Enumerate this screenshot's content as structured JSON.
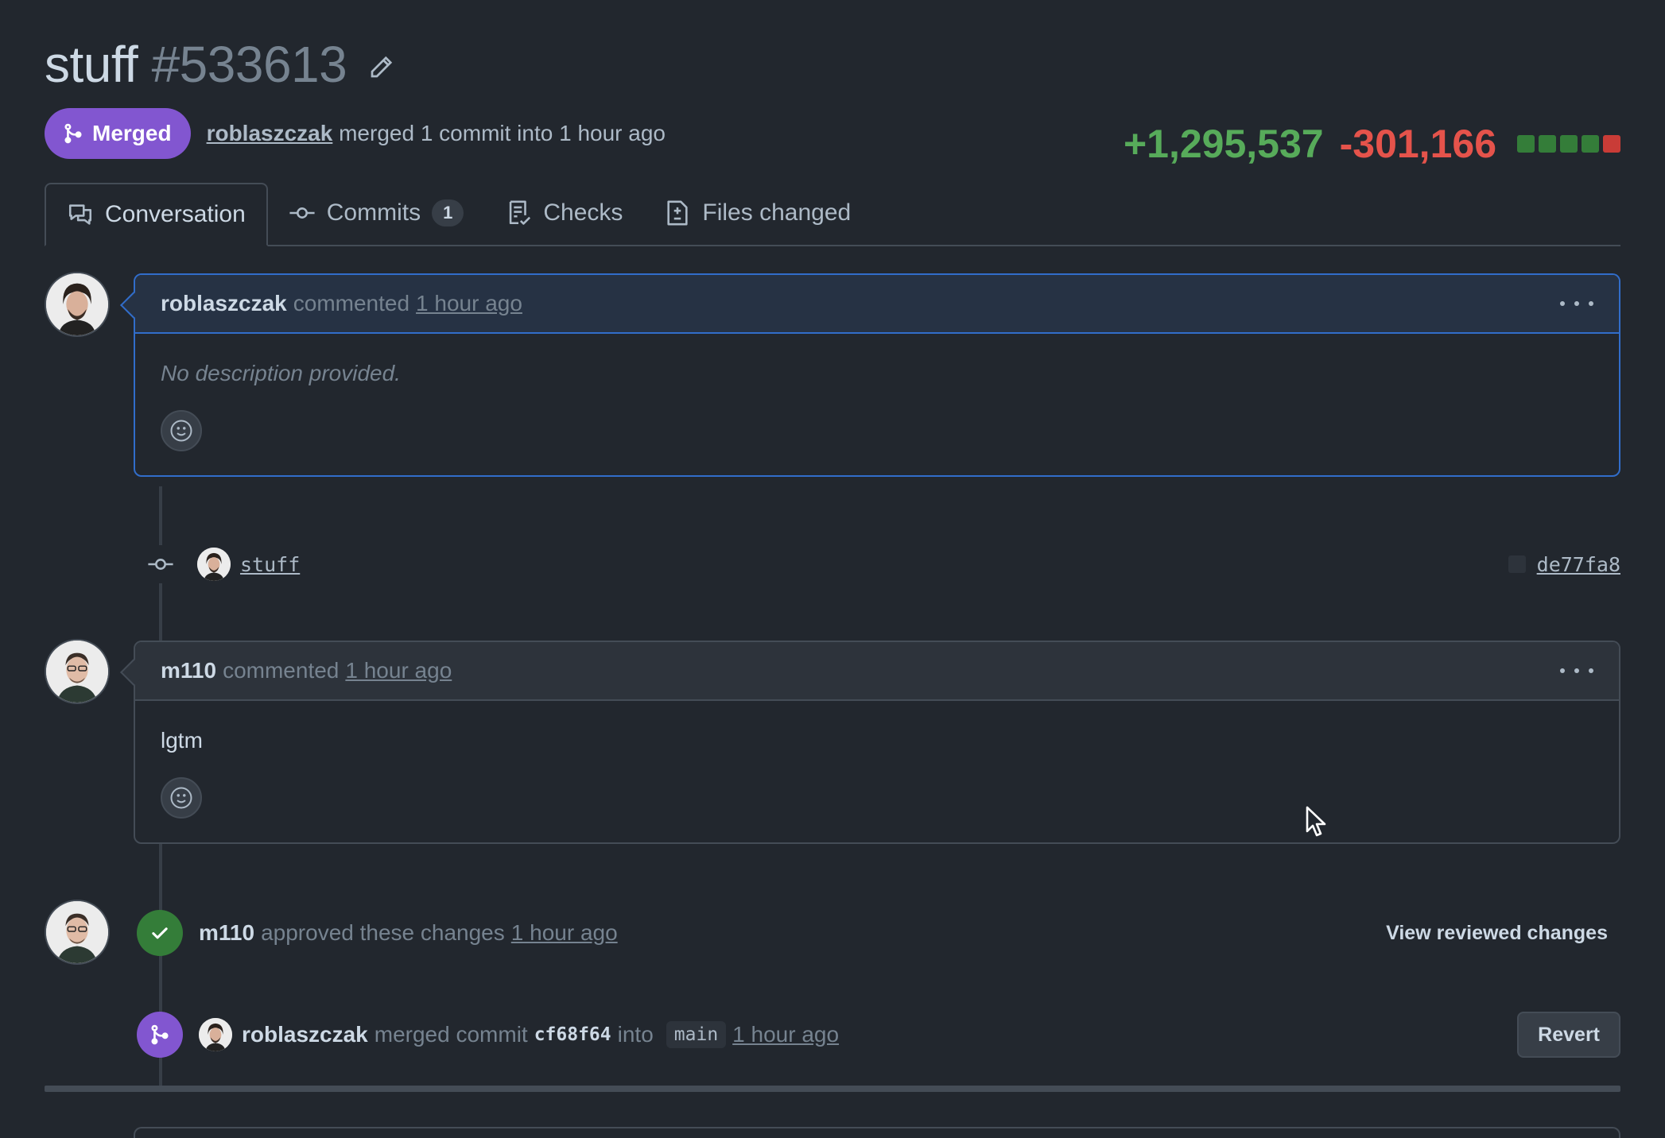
{
  "header": {
    "title": "stuff",
    "number": "#533613",
    "status_label": "Merged",
    "author": "roblaszczak",
    "meta_text": "merged 1 commit into  1 hour ago"
  },
  "diffstat": {
    "additions": "+1,295,537",
    "deletions": "-301,166",
    "bar_colors": [
      "#347d39",
      "#347d39",
      "#347d39",
      "#347d39",
      "#c93c37"
    ]
  },
  "tabs": [
    {
      "label": "Conversation",
      "icon": "comment-discussion-icon"
    },
    {
      "label": "Commits",
      "icon": "git-commit-icon",
      "counter": "1"
    },
    {
      "label": "Checks",
      "icon": "checklist-icon"
    },
    {
      "label": "Files changed",
      "icon": "file-diff-icon"
    }
  ],
  "timeline": {
    "first_comment": {
      "author": "roblaszczak",
      "verb": "commented",
      "time": "1 hour ago",
      "body": "No description provided."
    },
    "commit": {
      "message": "stuff",
      "sha": "de77fa8"
    },
    "second_comment": {
      "author": "m110",
      "verb": "commented",
      "time": "1 hour ago",
      "body": "lgtm"
    },
    "review": {
      "author": "m110",
      "verb": "approved these changes",
      "time": "1 hour ago",
      "action_label": "View reviewed changes"
    },
    "merge": {
      "author": "roblaszczak",
      "verb": "merged commit",
      "sha": "cf68f64",
      "into": "into",
      "branch": "main",
      "time": "1 hour ago",
      "revert_label": "Revert"
    }
  },
  "colors": {
    "merged": "#8256d0",
    "approved": "#347d39",
    "accent_border": "#316dca"
  }
}
